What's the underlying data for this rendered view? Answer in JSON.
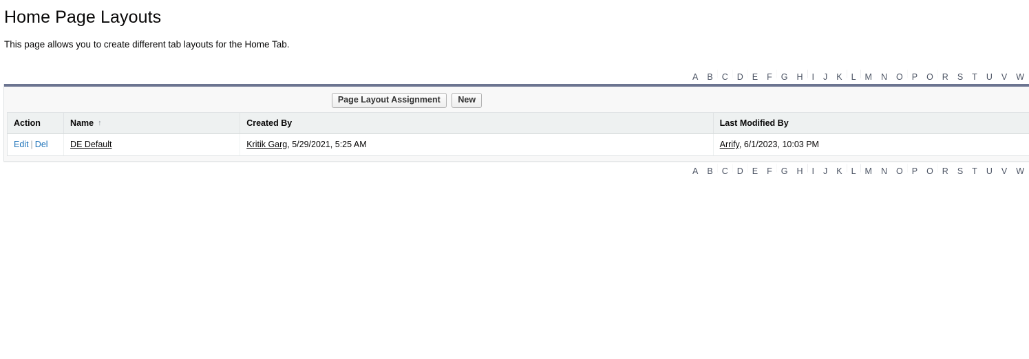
{
  "page": {
    "title": "Home Page Layouts",
    "description": "This page allows you to create different tab layouts for the Home Tab."
  },
  "alphabet_filter": {
    "letters": [
      "A",
      "B",
      "C",
      "D",
      "E",
      "F",
      "G",
      "H",
      "I",
      "J",
      "K",
      "L",
      "M",
      "N",
      "O",
      "P",
      "Q",
      "R",
      "S",
      "T",
      "U",
      "V",
      "W"
    ],
    "separator": "|"
  },
  "toolbar": {
    "page_layout_assignment_label": "Page Layout Assignment",
    "new_label": "New"
  },
  "table": {
    "columns": [
      {
        "label": "Action",
        "sort_arrow": ""
      },
      {
        "label": "Name",
        "sort_arrow": "↑"
      },
      {
        "label": "Created By",
        "sort_arrow": ""
      },
      {
        "label": "Last Modified By",
        "sort_arrow": ""
      }
    ],
    "rows": [
      {
        "edit_label": "Edit",
        "action_separator": "|",
        "del_label": "Del",
        "name": "DE Default",
        "created_by_user": "Kritik Garg",
        "created_by_date": ", 5/29/2021, 5:25 AM",
        "modified_by_user": "Arrify",
        "modified_by_date": ", 6/1/2023, 10:03 PM"
      }
    ]
  },
  "colors": {
    "panel_topbar": "#6b7490",
    "link_blue": "#1b71b8",
    "header_bg": "#eef1f1",
    "panel_bg": "#f8f8f8",
    "alpha_letter": "#4c5464"
  }
}
